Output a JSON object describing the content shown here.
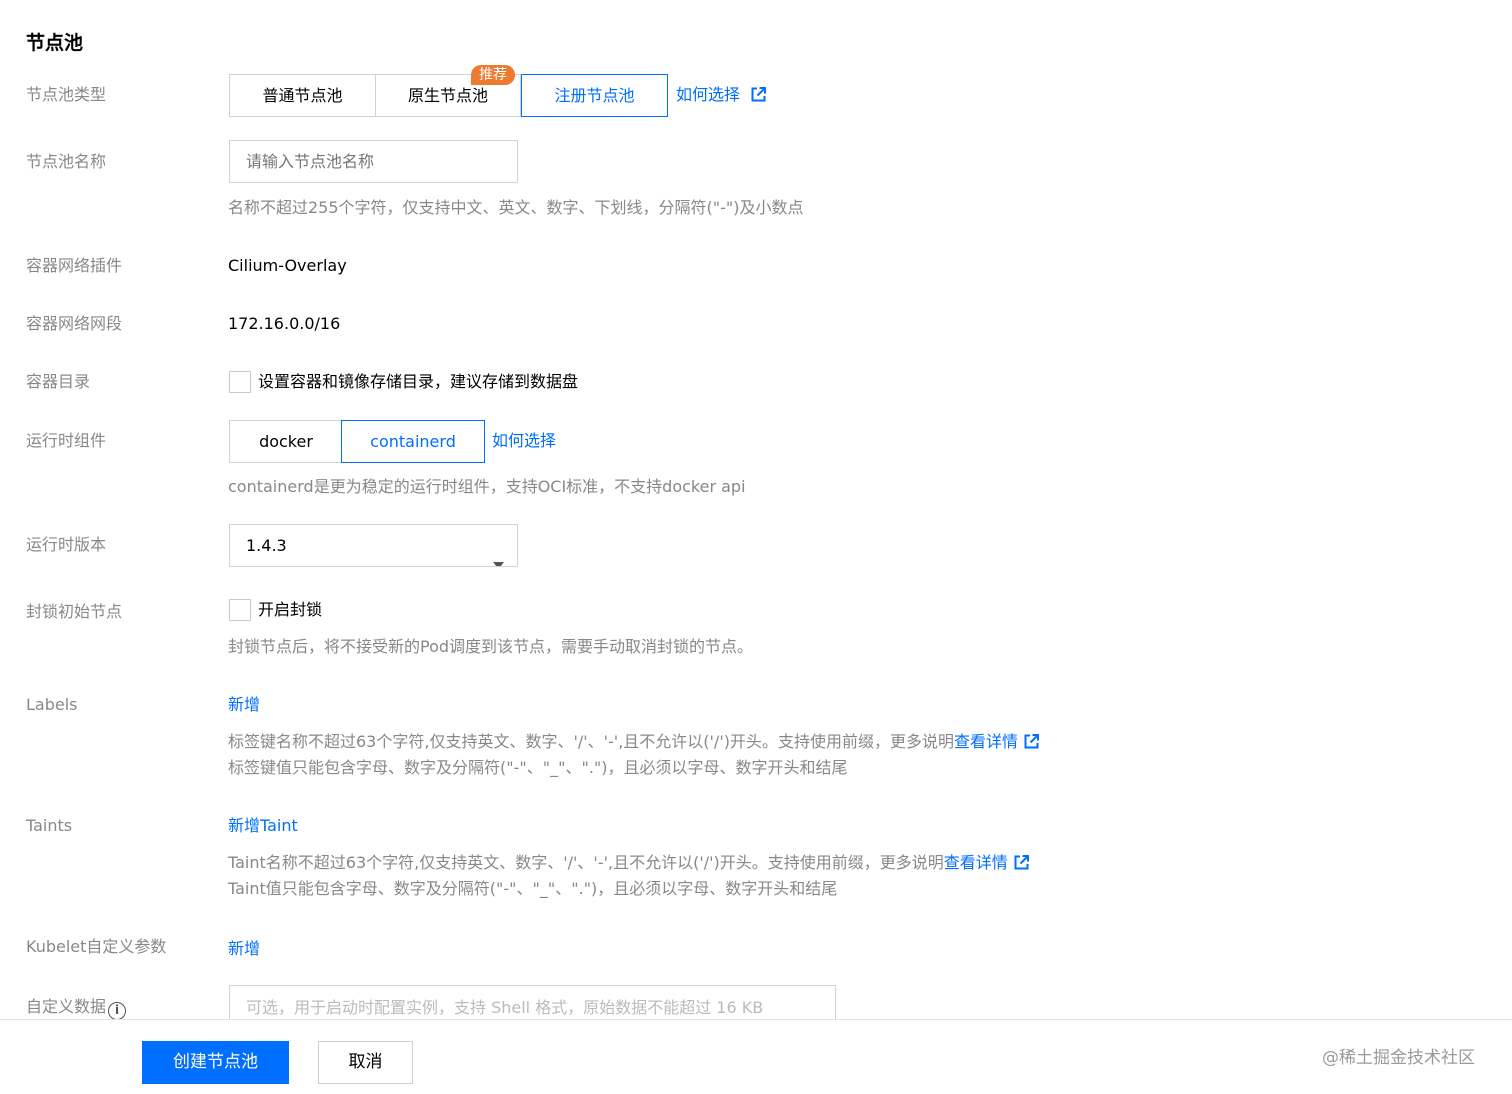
{
  "section": {
    "title": "节点池"
  },
  "rows": {
    "pool_type": {
      "label": "节点池类型",
      "options": [
        "普通节点池",
        "原生节点池",
        "注册节点池"
      ],
      "selected": "注册节点池",
      "badge": "推荐",
      "help_link": "如何选择"
    },
    "pool_name": {
      "label": "节点池名称",
      "placeholder": "请输入节点池名称",
      "help": "名称不超过255个字符，仅支持中文、英文、数字、下划线，分隔符(\"-\")及小数点"
    },
    "cni_plugin": {
      "label": "容器网络插件",
      "value": "Cilium-Overlay"
    },
    "cni_cidr": {
      "label": "容器网络网段",
      "value": "172.16.0.0/16"
    },
    "container_dir": {
      "label": "容器目录",
      "checkbox_label": "设置容器和镜像存储目录，建议存储到数据盘"
    },
    "runtime": {
      "label": "运行时组件",
      "options": [
        "docker",
        "containerd"
      ],
      "selected": "containerd",
      "help_link": "如何选择",
      "help": "containerd是更为稳定的运行时组件，支持OCI标准，不支持docker api"
    },
    "runtime_version": {
      "label": "运行时版本",
      "value": "1.4.3"
    },
    "cordon": {
      "label": "封锁初始节点",
      "checkbox_label": "开启封锁",
      "help": "封锁节点后，将不接受新的Pod调度到该节点，需要手动取消封锁的节点。"
    },
    "labels": {
      "label": "Labels",
      "add_link": "新增",
      "help_line1": "标签键名称不超过63个字符,仅支持英文、数字、'/'、'-',且不允许以('/')开头。支持使用前缀，更多说明",
      "help_line1_link": "查看详情",
      "help_line2": "标签键值只能包含字母、数字及分隔符(\"-\"、\"_\"、\".\")，且必须以字母、数字开头和结尾"
    },
    "taints": {
      "label": "Taints",
      "add_link": "新增Taint",
      "help_line1": "Taint名称不超过63个字符,仅支持英文、数字、'/'、'-',且不允许以('/')开头。支持使用前缀，更多说明",
      "help_line1_link": "查看详情",
      "help_line2": "Taint值只能包含字母、数字及分隔符(\"-\"、\"_\"、\".\")，且必须以字母、数字开头和结尾"
    },
    "kubelet": {
      "label": "Kubelet自定义参数",
      "add_link": "新增"
    },
    "user_data": {
      "label": "自定义数据",
      "info_icon_text": "i",
      "placeholder": "可选，用于启动时配置实例，支持 Shell 格式，原始数据不能超过 16 KB"
    }
  },
  "footer": {
    "create_button": "创建节点池",
    "cancel_button": "取消"
  },
  "watermark": "@稀土掘金技术社区",
  "colors": {
    "primary": "#006eff",
    "badge": "#ed7a2e",
    "label": "#888888"
  }
}
